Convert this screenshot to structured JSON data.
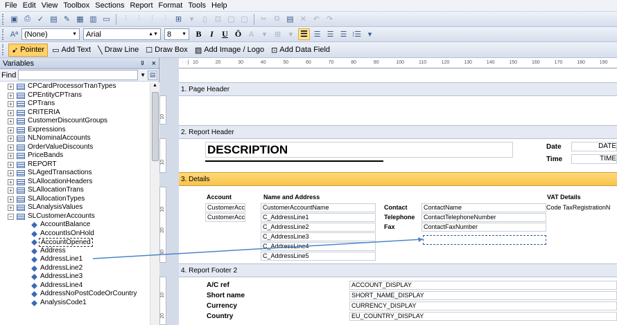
{
  "menu": [
    "File",
    "Edit",
    "View",
    "Toolbox",
    "Sections",
    "Report",
    "Format",
    "Tools",
    "Help"
  ],
  "style_toolbar": {
    "style_value": "(None)",
    "font_value": "Arial",
    "size_value": "8",
    "bold": "B",
    "italic": "I",
    "underline": "U",
    "overline": "Ō"
  },
  "tools": {
    "pointer": "Pointer",
    "add_text": "Add Text",
    "draw_line": "Draw Line",
    "draw_box": "Draw Box",
    "add_image": "Add Image / Logo",
    "add_data_field": "Add Data Field"
  },
  "variables_panel": {
    "title": "Variables",
    "pin": "ᵍ",
    "close": "×",
    "find_label": "Find",
    "tables": [
      "CPCardProcessorTranTypes",
      "CPEntityCPTrans",
      "CPTrans",
      "CRITERIA",
      "CustomerDiscountGroups",
      "Expressions",
      "NLNominalAccounts",
      "OrderValueDiscounts",
      "PriceBands",
      "REPORT",
      "SLAgedTransactions",
      "SLAllocationHeaders",
      "SLAllocationTrans",
      "SLAllocationTypes",
      "SLAnalysisValues",
      "SLCustomerAccounts"
    ],
    "fields": [
      "AccountBalance",
      "AccountIsOnHold",
      "AccountOpened",
      "Address",
      "AddressLine1",
      "AddressLine2",
      "AddressLine3",
      "AddressLine4",
      "AddressNoPostCodeOrCountry",
      "AnalysisCode1"
    ],
    "selected_field": "AccountOpened"
  },
  "ruler": [
    "10",
    "20",
    "30",
    "40",
    "50",
    "60",
    "70",
    "80",
    "90",
    "100",
    "110",
    "120",
    "130",
    "140",
    "150",
    "160",
    "170",
    "180",
    "190"
  ],
  "vruler": {
    "page_header": "10",
    "report_header": "10",
    "details_a": "10",
    "details_b": "20",
    "details_c": "30",
    "footer_a": "10",
    "footer_b": "20"
  },
  "bands": {
    "page_header": "1. Page Header",
    "report_header": "2. Report Header",
    "details": "3. Details",
    "report_footer": "4. Report Footer 2"
  },
  "report_header": {
    "title": "DESCRIPTION",
    "date_label": "Date",
    "date_value": "DATE",
    "time_label": "Time",
    "time_value": "TIME"
  },
  "details": {
    "account_header": "Account",
    "name_address_header": "Name and Address",
    "vat_header": "VAT Details",
    "account_field_1": "CustomerAcc",
    "account_field_2": "CustomerAcc",
    "name_field": "CustomerAccountName",
    "address_lines": [
      "C_AddressLine1",
      "C_AddressLine2",
      "C_AddressLine3",
      "C_AddressLine4",
      "C_AddressLine5"
    ],
    "contact_label": "Contact",
    "contact_value": "ContactName",
    "telephone_label": "Telephone",
    "telephone_value": "ContactTelephoneNumber",
    "fax_label": "Fax",
    "fax_value": "ContactFaxNumber",
    "vat_value": "Code TaxRegistrationN"
  },
  "footer": {
    "rows": [
      {
        "label": "A/C ref",
        "value": "ACCOUNT_DISPLAY"
      },
      {
        "label": "Short name",
        "value": "SHORT_NAME_DISPLAY"
      },
      {
        "label": "Currency",
        "value": "CURRENCY_DISPLAY"
      },
      {
        "label": "Country",
        "value": "EU_COUNTRY_DISPLAY"
      }
    ]
  },
  "colors": {
    "active_band": "#f8c34b",
    "drag_line": "#4a86c8"
  }
}
